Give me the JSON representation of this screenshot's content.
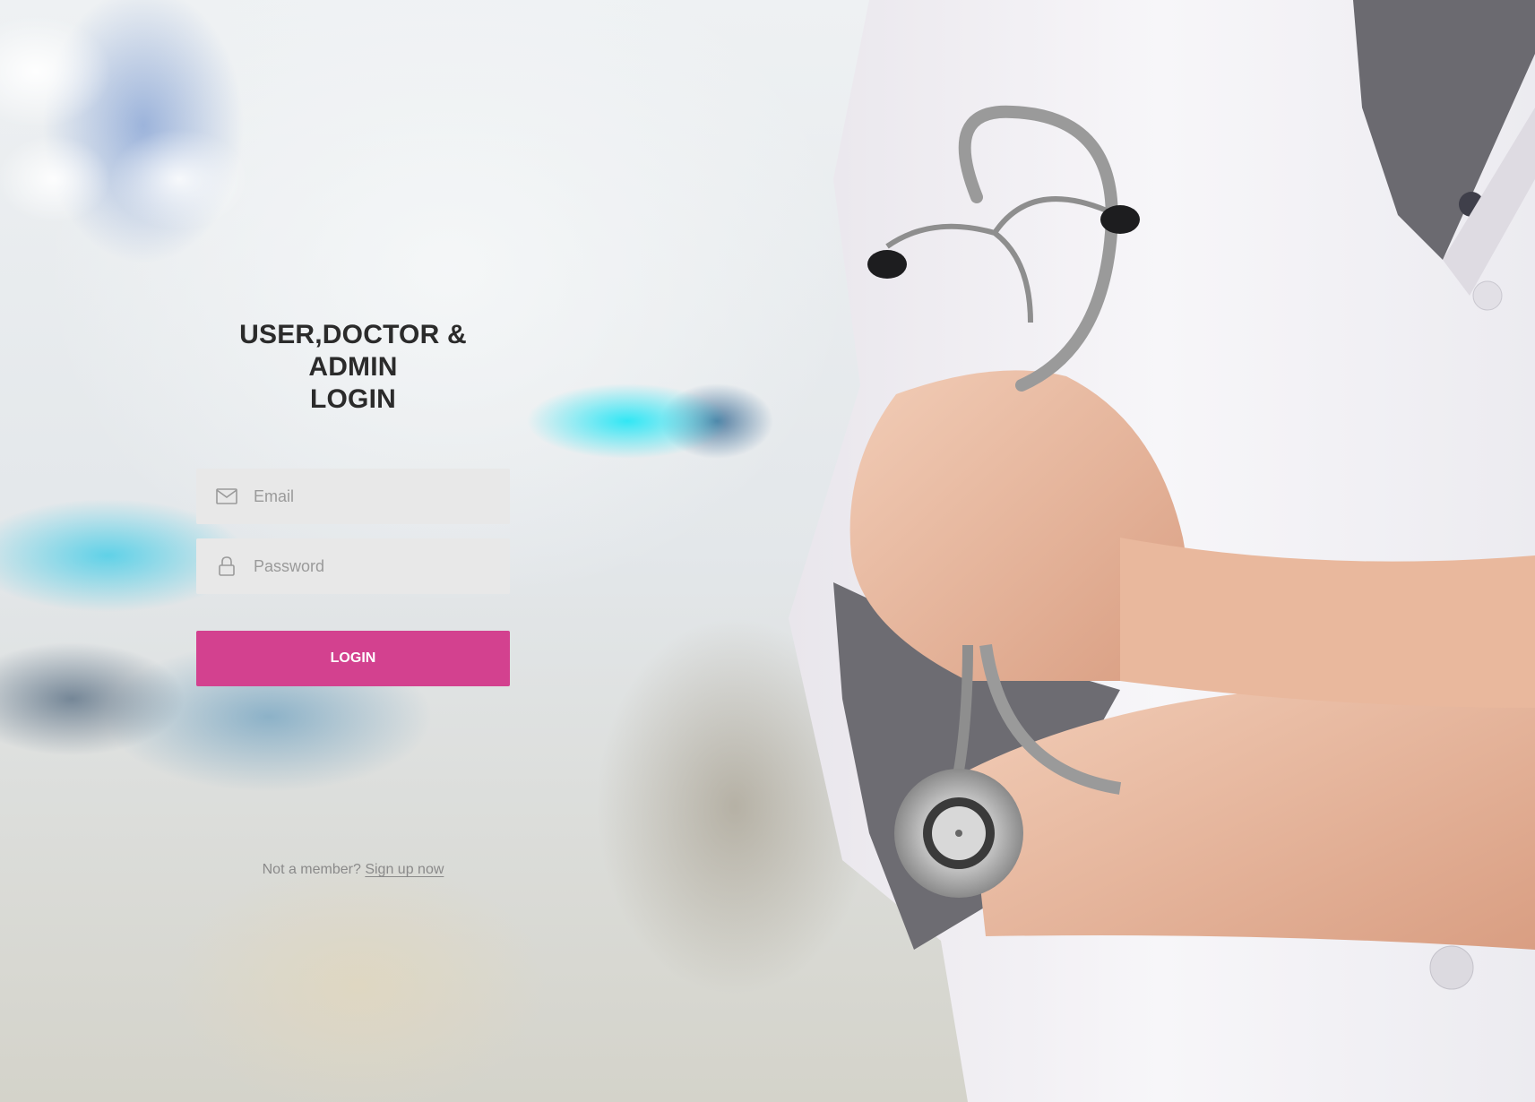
{
  "login": {
    "title_line1": "USER,DOCTOR & ADMIN",
    "title_line2": "LOGIN",
    "email_placeholder": "Email",
    "email_icon": "mail-icon",
    "password_placeholder": "Password",
    "password_icon": "lock-icon",
    "button_label": "LOGIN"
  },
  "signup": {
    "prompt": "Not a member?",
    "link_label": "Sign up now"
  },
  "colors": {
    "accent": "#d3418f",
    "field_bg": "#e8e8e8",
    "title": "#2b2b2b"
  }
}
